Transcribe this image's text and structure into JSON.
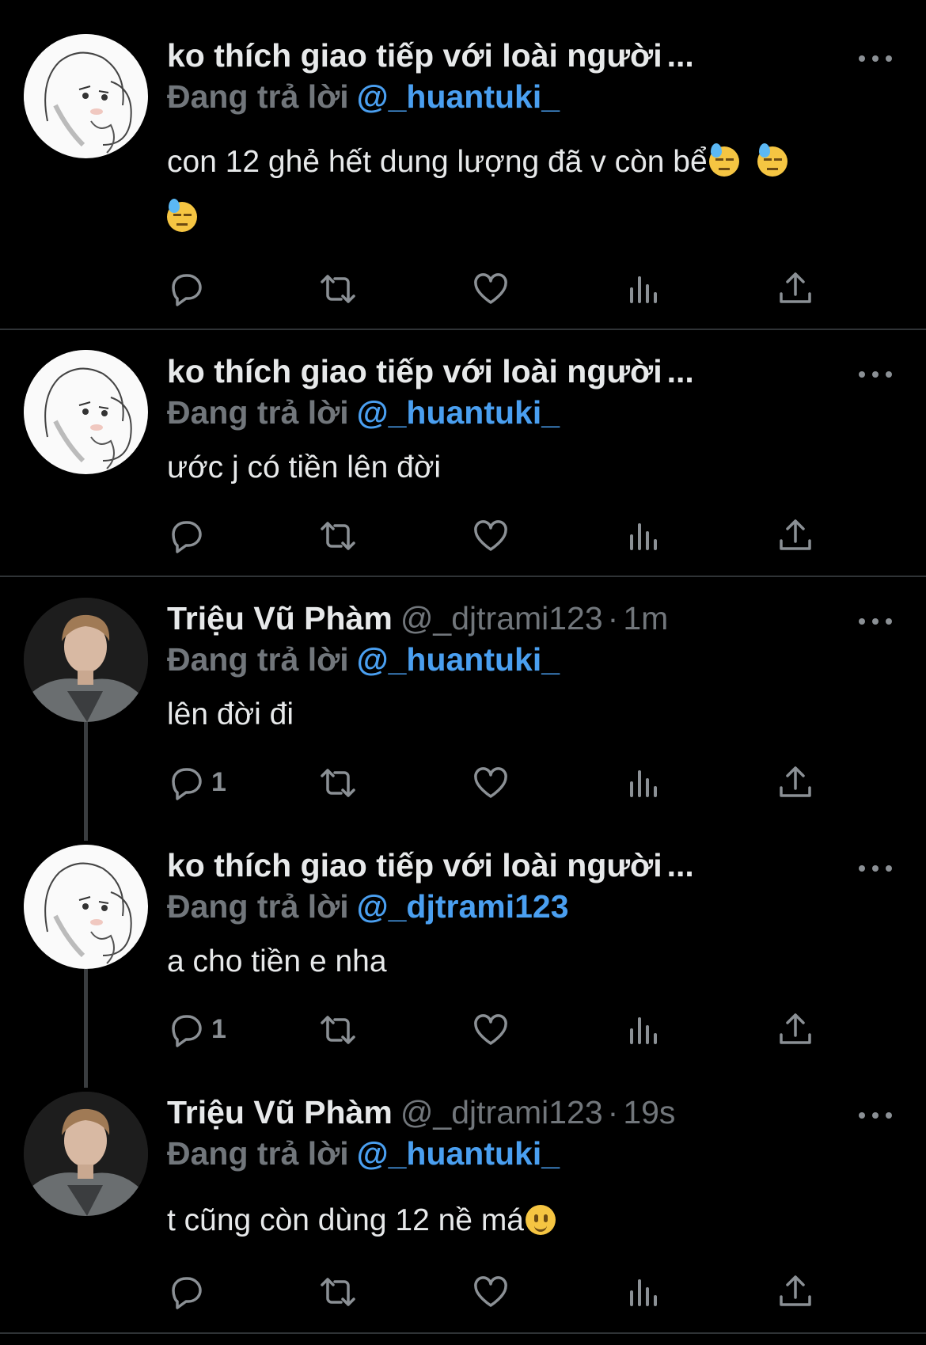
{
  "tweets": [
    {
      "author": "ko thích giao tiếp với loài người",
      "truncated": "...",
      "handle": "",
      "time": "",
      "reply_label": "Đang trả lời",
      "reply_to": "@_huantuki_",
      "text": "con 12 ghẻ hết dung lượng đã v còn bể",
      "emojis": [
        "downcast-sweat-face-emoji",
        "downcast-sweat-face-emoji",
        "downcast-sweat-face-emoji"
      ],
      "reply_count": ""
    },
    {
      "author": "ko thích giao tiếp với loài người",
      "truncated": "...",
      "handle": "",
      "time": "",
      "reply_label": "Đang trả lời",
      "reply_to": "@_huantuki_",
      "text": "ước j có tiền lên đời",
      "reply_count": ""
    },
    {
      "author": "Triệu Vũ Phàm",
      "handle": "@_djtrami123",
      "sep": "·",
      "time": "1m",
      "reply_label": "Đang trả lời",
      "reply_to": "@_huantuki_",
      "text": "lên đời đi",
      "reply_count": "1"
    },
    {
      "author": "ko thích giao tiếp với loài người",
      "truncated": "...",
      "handle": "",
      "time": "",
      "reply_label": "Đang trả lời",
      "reply_to": "@_djtrami123",
      "text": "a cho tiền e nha",
      "reply_count": "1"
    },
    {
      "author": "Triệu Vũ Phàm",
      "handle": "@_djtrami123",
      "sep": "·",
      "time": "19s",
      "reply_label": "Đang trả lời",
      "reply_to": "@_huantuki_",
      "text": "t cũng còn dùng 12 nề má",
      "emojis": [
        "slightly-smiling-face-emoji"
      ],
      "reply_count": ""
    }
  ],
  "colors": {
    "background": "#000000",
    "text": "#e7e9ea",
    "secondary": "#71767b",
    "mention": "#4a9ff0",
    "divider": "#2f3336"
  },
  "icons": [
    "reply-icon",
    "retweet-icon",
    "like-icon",
    "views-icon",
    "share-icon",
    "more-options-icon"
  ]
}
